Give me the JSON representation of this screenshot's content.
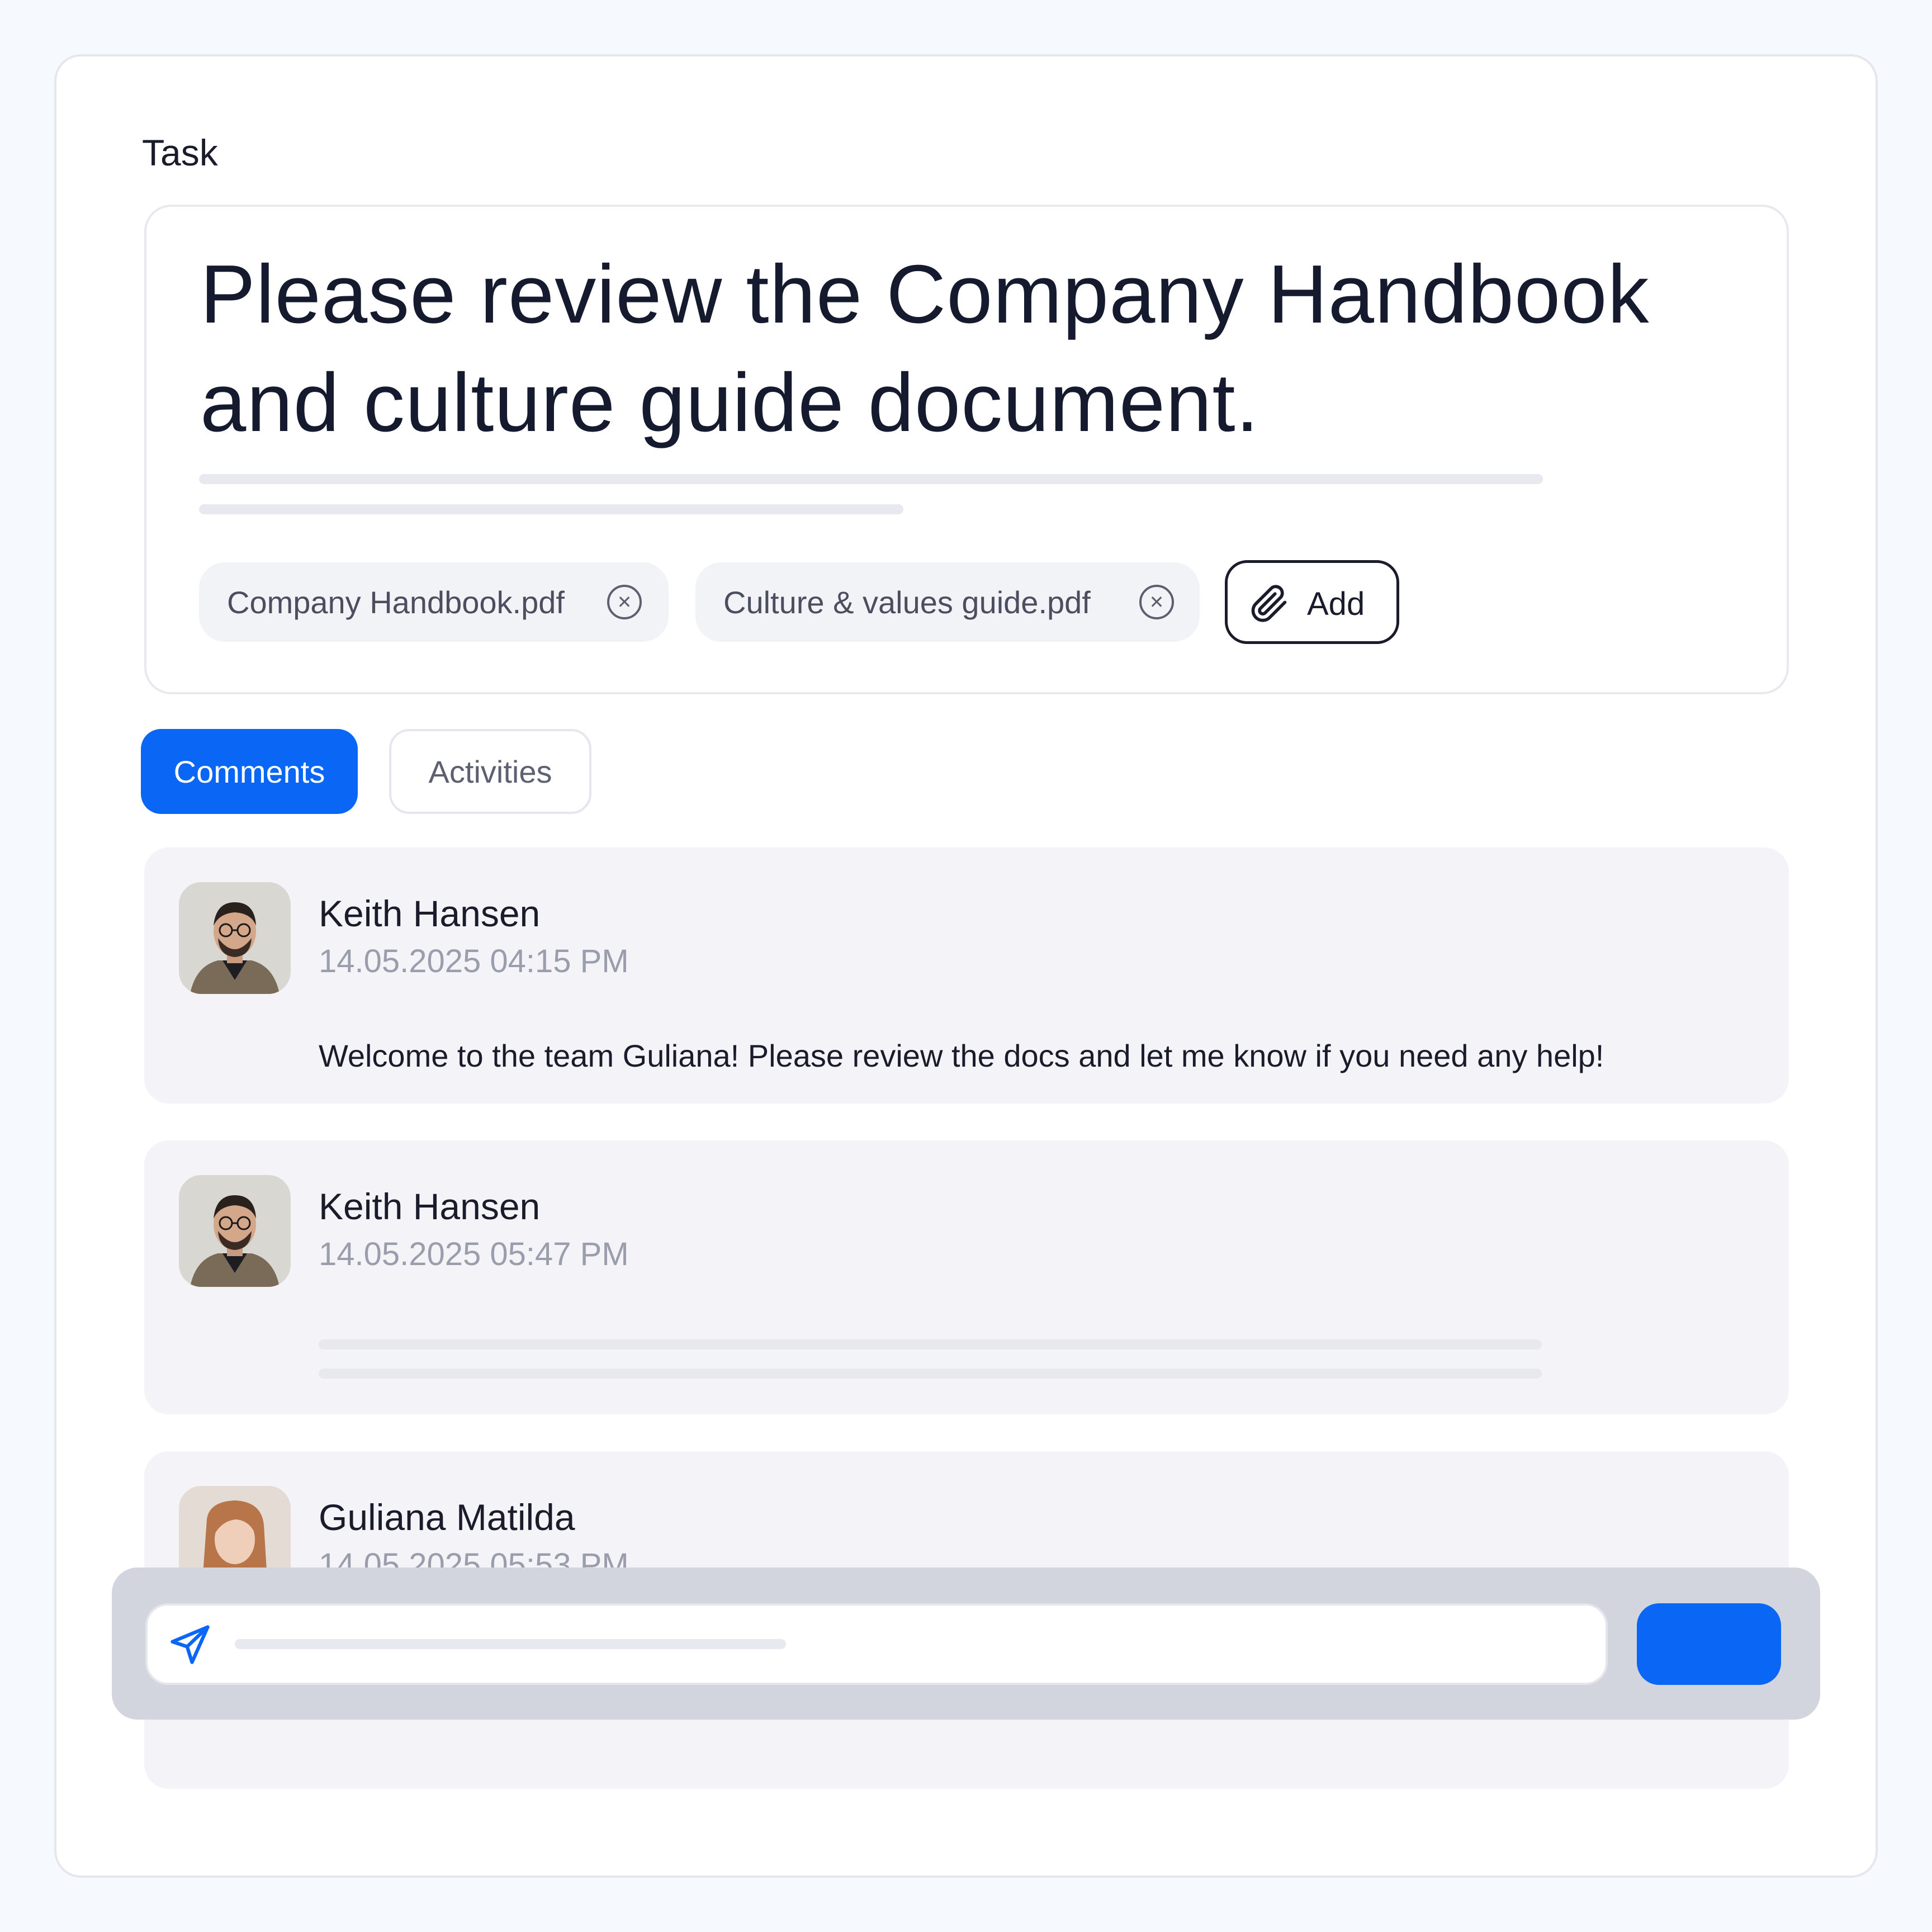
{
  "section": {
    "label": "Task"
  },
  "task": {
    "title": "Please review the Company Handbook and culture guide document.",
    "attachments": [
      {
        "name": "Company Handbook.pdf",
        "remove_icon": "close-circle-icon"
      },
      {
        "name": "Culture & values guide.pdf",
        "remove_icon": "close-circle-icon"
      }
    ],
    "add_button": {
      "label": "Add",
      "icon": "paperclip-icon"
    }
  },
  "tabs": [
    {
      "label": "Comments",
      "active": true
    },
    {
      "label": "Activities",
      "active": false
    }
  ],
  "comments": [
    {
      "author": "Keith Hansen",
      "timestamp": "14.05.2025 04:15 PM",
      "text": "Welcome to the team Guliana! Please review the docs and let me know if you need any help!"
    },
    {
      "author": "Keith Hansen",
      "timestamp": "14.05.2025 05:47 PM",
      "text": ""
    },
    {
      "author": "Guliana Matilda",
      "timestamp": "14.05.2025 05:53 PM",
      "text": ""
    }
  ],
  "composer": {
    "icon": "send-icon",
    "submit_color": "#0a66f5"
  },
  "colors": {
    "accent": "#0a66f5",
    "card_bg": "#f4f4f8",
    "page_bg": "#f6f9fd"
  }
}
